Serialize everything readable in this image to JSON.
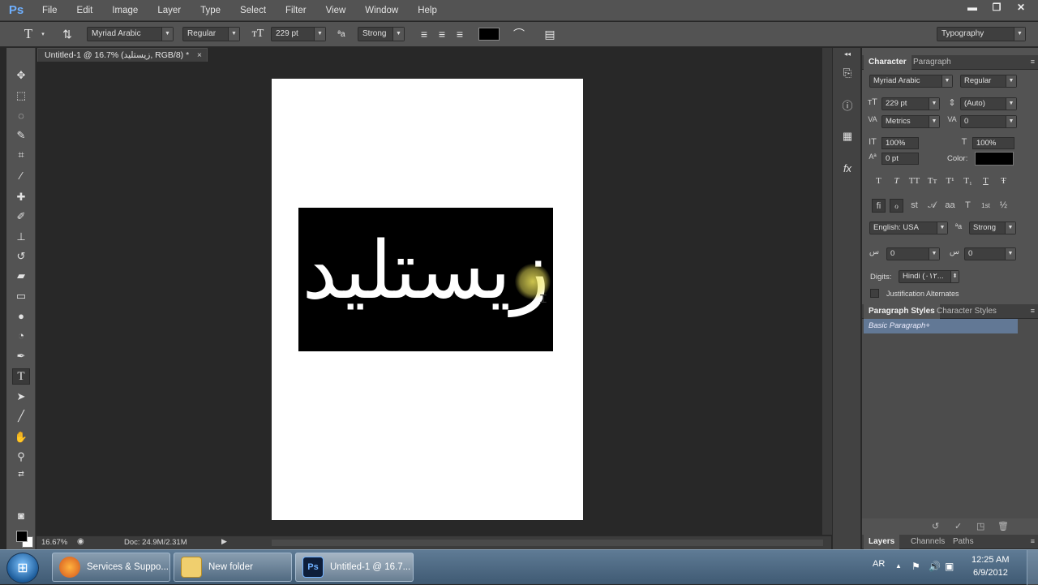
{
  "app": {
    "logo": "Ps"
  },
  "menu": [
    "File",
    "Edit",
    "Image",
    "Layer",
    "Type",
    "Select",
    "Filter",
    "View",
    "Window",
    "Help"
  ],
  "window_controls": {
    "minimize": "▬",
    "restore": "❐",
    "close": "✕"
  },
  "options_bar": {
    "tool_glyph": "T",
    "font_family": "Myriad Arabic",
    "font_style": "Regular",
    "font_size": "229 pt",
    "antialias_icon": "ªa",
    "antialias": "Strong",
    "text_color": "#000000"
  },
  "workspace": "Typography",
  "document_tab": {
    "title": "Untitled-1 @ 16.7% (زيستليد, RGB/8) *",
    "close": "×"
  },
  "canvas": {
    "text": "زيستليد",
    "text_color": "#ffffff",
    "block_color": "#000000"
  },
  "status": {
    "zoom": "16.67%",
    "doc": "Doc: 24.9M/2.31M"
  },
  "character_panel": {
    "tabs": [
      "Character",
      "Paragraph"
    ],
    "font_family": "Myriad Arabic",
    "font_style": "Regular",
    "size": "229 pt",
    "leading": "(Auto)",
    "kerning": "Metrics",
    "tracking": "0",
    "vertical_scale": "100%",
    "horizontal_scale": "100%",
    "baseline_shift": "0 pt",
    "color_label": "Color:",
    "color": "#000000",
    "style_buttons": [
      "T",
      "T",
      "TT",
      "Tт",
      "T¹",
      "T₁",
      "T",
      "Ŧ"
    ],
    "opentype_buttons": [
      "ﬁ",
      "ℴ",
      "st",
      "𝒜",
      "aa",
      "T",
      "1st",
      "½"
    ],
    "language": "English: USA",
    "antialias": "Strong",
    "kashida_left": "0",
    "kashida_right": "0",
    "digits_label": "Digits:",
    "digits": "Hindi (٠١٢...",
    "justification": "Justification Alternates"
  },
  "paragraph_styles": {
    "tabs": [
      "Paragraph Styles",
      "Character Styles"
    ],
    "items": [
      "Basic Paragraph+"
    ]
  },
  "layers_tabs": [
    "Layers",
    "Channels",
    "Paths"
  ],
  "taskbar": {
    "tasks": [
      {
        "label": "Services & Suppo...",
        "icon": "firefox-icon"
      },
      {
        "label": "New folder",
        "icon": "folder-icon"
      },
      {
        "label": "Untitled-1 @ 16.7...",
        "icon": "photoshop-icon"
      }
    ],
    "language": "AR",
    "time": "12:25 AM",
    "date": "6/9/2012"
  }
}
